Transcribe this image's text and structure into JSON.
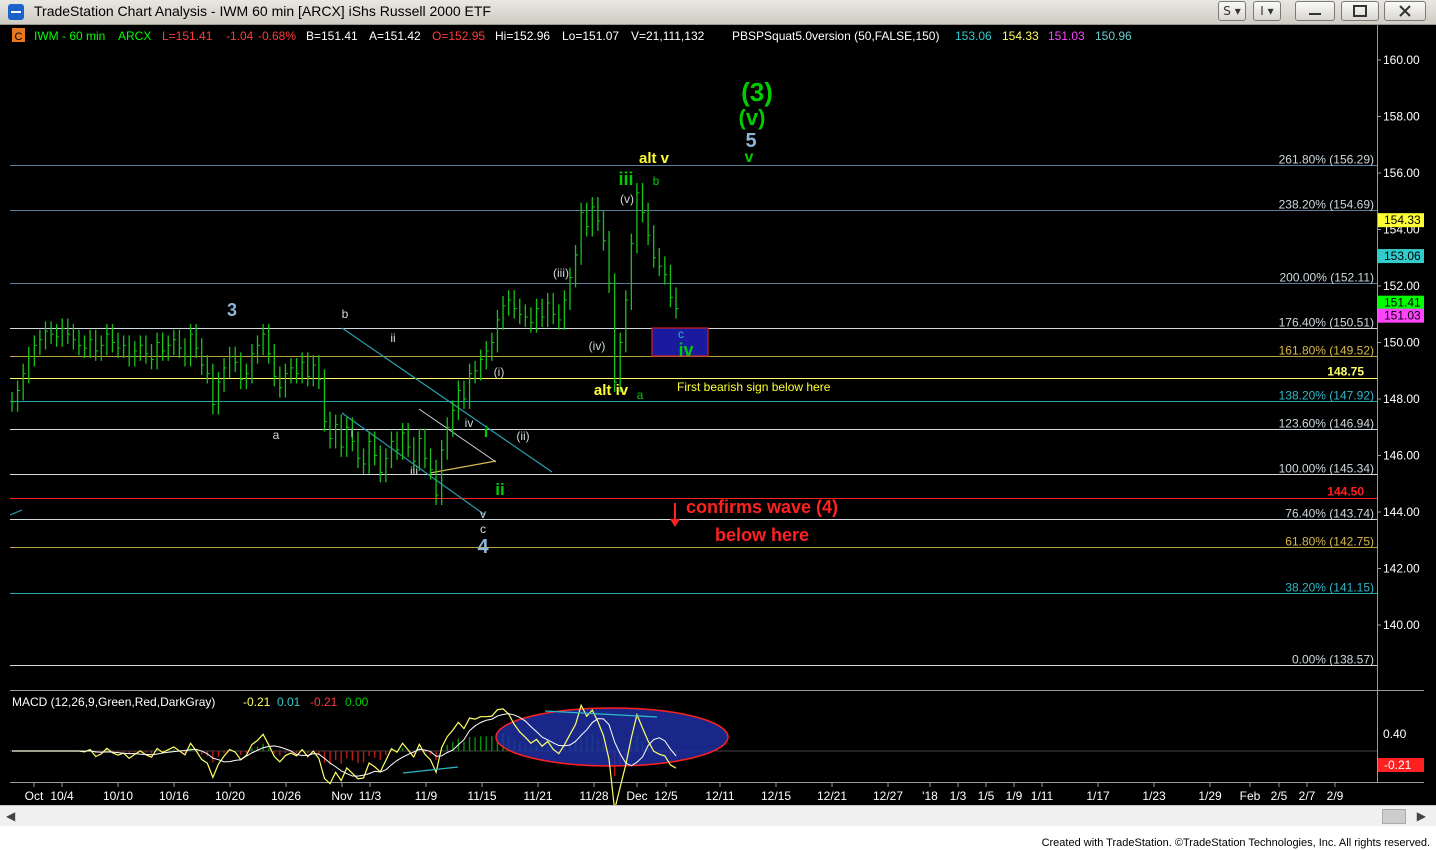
{
  "window": {
    "title": "TradeStation Chart Analysis - IWM 60 min [ARCX] iShs Russell 2000 ETF",
    "btn_s": "S ▾",
    "btn_i": "I ▾"
  },
  "header": {
    "symbol_badge": "C",
    "symbol": "IWM - 60 min",
    "exchange": "ARCX",
    "last": "L=151.41",
    "net_change": "-1.04",
    "pct_change": "-0.68%",
    "bid": "B=151.41",
    "ask": "A=151.42",
    "open": "O=152.95",
    "high": "Hi=152.96",
    "low": "Lo=151.07",
    "volume": "V=21,111,132",
    "indicator": "PBSPSquat5.0version (50,FALSE,150)",
    "ind_values": [
      "153.06",
      "154.33",
      "151.03",
      "150.96"
    ],
    "colors": {
      "symbol": "#00ff00",
      "price": "#ffffff",
      "neg": "#ff3b3b",
      "ind1": "#33cccc",
      "ind2": "#ffff66",
      "ind3": "#ff44ff",
      "ind4": "#66cccc"
    }
  },
  "chart_data": {
    "type": "line",
    "price_axis": {
      "ticks": [
        "160.00",
        "158.00",
        "156.00",
        "154.00",
        "152.00",
        "150.00",
        "148.00",
        "146.00",
        "144.00",
        "142.00",
        "140.00"
      ],
      "ylim": [
        138.2,
        161.2
      ]
    },
    "x_axis": {
      "ticks": [
        "Oct",
        "10/4",
        "10/10",
        "10/16",
        "10/20",
        "10/26",
        "Nov",
        "11/3",
        "11/9",
        "11/15",
        "11/21",
        "11/28",
        "Dec",
        "12/5",
        "12/11",
        "12/15",
        "12/21",
        "12/27",
        "'18",
        "1/3",
        "1/5",
        "1/9",
        "1/11",
        "1/17",
        "1/23",
        "1/29",
        "Feb",
        "2/5",
        "2/7",
        "2/9"
      ]
    },
    "price_series_hourly": [
      147.9,
      148.3,
      148.9,
      149.5,
      149.9,
      150.1,
      150.4,
      150.3,
      150.2,
      150.5,
      150.3,
      150.1,
      149.9,
      149.8,
      150.1,
      149.7,
      149.9,
      150.3,
      150.0,
      149.8,
      149.9,
      149.5,
      149.7,
      149.9,
      149.6,
      149.4,
      150.0,
      149.7,
      149.9,
      150.1,
      149.8,
      149.5,
      150.3,
      149.8,
      149.2,
      148.9,
      147.8,
      148.6,
      149.1,
      149.5,
      149.3,
      148.7,
      148.9,
      149.6,
      149.9,
      150.3,
      149.6,
      148.8,
      148.4,
      148.9,
      149.1,
      148.9,
      149.3,
      148.8,
      149.2,
      148.7,
      147.2,
      146.6,
      147.1,
      146.3,
      147.0,
      146.5,
      145.9,
      145.7,
      146.5,
      146.0,
      145.4,
      145.9,
      146.5,
      146.2,
      146.8,
      146.3,
      145.8,
      146.6,
      145.9,
      145.5,
      144.6,
      146.2,
      147.0,
      147.6,
      148.3,
      148.0,
      148.9,
      149.0,
      149.4,
      149.7,
      150.0,
      150.8,
      151.3,
      151.5,
      151.2,
      151.0,
      150.9,
      150.7,
      151.2,
      150.9,
      151.4,
      151.0,
      150.8,
      151.5,
      152.3,
      153.1,
      154.6,
      154.1,
      154.8,
      154.3,
      153.6,
      152.1,
      148.6,
      150.0,
      151.5,
      153.5,
      155.3,
      154.6,
      153.8,
      153.0,
      152.7,
      152.4,
      151.6,
      151.2
    ],
    "fib_levels": [
      {
        "label": "261.80% (156.29)",
        "value": 156.29,
        "line_color": "#5b7d9a",
        "text_color": "#cfd8dc"
      },
      {
        "label": "238.20% (154.69)",
        "value": 154.69,
        "line_color": "#5b7d9a",
        "text_color": "#cfd8dc"
      },
      {
        "label": "200.00% (152.11)",
        "value": 152.11,
        "line_color": "#5b7d9a",
        "text_color": "#cfd8dc"
      },
      {
        "label": "176.40% (150.51)",
        "value": 150.51,
        "line_color": "#cfd8dc",
        "text_color": "#cfd8dc"
      },
      {
        "label": "161.80% (149.52)",
        "value": 149.52,
        "line_color": "#b8a040",
        "text_color": "#d8b84a"
      },
      {
        "label": "138.20% (147.92)",
        "value": 147.92,
        "line_color": "#2aa0b0",
        "text_color": "#2fb8c8"
      },
      {
        "label": "123.60% (146.94)",
        "value": 146.94,
        "line_color": "#cfd8dc",
        "text_color": "#cfd8dc"
      },
      {
        "label": "100.00% (145.34)",
        "value": 145.34,
        "line_color": "#cfd8dc",
        "text_color": "#cfd8dc"
      },
      {
        "label": "76.40% (143.74)",
        "value": 143.74,
        "line_color": "#cfd8dc",
        "text_color": "#cfd8dc"
      },
      {
        "label": "61.80% (142.75)",
        "value": 142.75,
        "line_color": "#b8a040",
        "text_color": "#d8b84a"
      },
      {
        "label": "38.20% (141.15)",
        "value": 141.15,
        "line_color": "#2aa0b0",
        "text_color": "#2fb8c8"
      },
      {
        "label": "0.00% (138.57)",
        "value": 138.57,
        "line_color": "#cfd8dc",
        "text_color": "#cfd8dc"
      }
    ],
    "horizontal_marks": [
      {
        "label": "148.75",
        "value": 148.75,
        "color": "#ffff66"
      },
      {
        "label": "144.50",
        "value": 144.5,
        "color": "#ff2020"
      }
    ],
    "price_badges": [
      {
        "label": "154.33",
        "bg": "#ffff33",
        "fg": "#000000"
      },
      {
        "label": "153.06",
        "bg": "#33cccc",
        "fg": "#000000"
      },
      {
        "label": "151.41",
        "bg": "#00ff00",
        "fg": "#000000"
      },
      {
        "label": "151.03",
        "bg": "#ff44ff",
        "fg": "#000000"
      }
    ],
    "wave_labels": {
      "w3_big": "(3)",
      "wv_paren": "(v)",
      "w5": "5",
      "wv_small": "v",
      "alt_v": "alt v",
      "iii_green": "iii",
      "b_small": "b",
      "v_paren": "(v)",
      "iii_paren": "(iii)",
      "iv_paren": "(iv)",
      "c_small": "c",
      "iv_green": "iv",
      "alt_iv": "alt iv",
      "a_small": "a",
      "i_paren": "(i)",
      "ii_paren": "(ii)",
      "i_green": "i",
      "ii_green": "ii",
      "iv_white": "iv",
      "iii_white": "iii",
      "v_white": "v",
      "c_white": "c",
      "w4": "4",
      "w3_left": "3",
      "b_left": "b",
      "ii_left": "ii",
      "i_left": "i",
      "a_left": "a"
    },
    "annotations": {
      "first_bearish": "First bearish sign below here",
      "confirms": "confirms wave (4)",
      "below": "below here"
    },
    "macd": {
      "label": "MACD (12,26,9,Green,Red,DarkGray)",
      "values": [
        "-0.21",
        "0.01",
        "-0.21",
        "0.00"
      ],
      "value_colors": [
        "#ffff66",
        "#33cccc",
        "#ff3b3b",
        "#00cc00"
      ],
      "axis_ticks": [
        "0.40"
      ],
      "badge": "-0.21",
      "ylim": [
        -0.6,
        0.6
      ]
    }
  },
  "footer": {
    "credits": "Created with TradeStation. ©TradeStation Technologies, Inc. All rights reserved."
  }
}
